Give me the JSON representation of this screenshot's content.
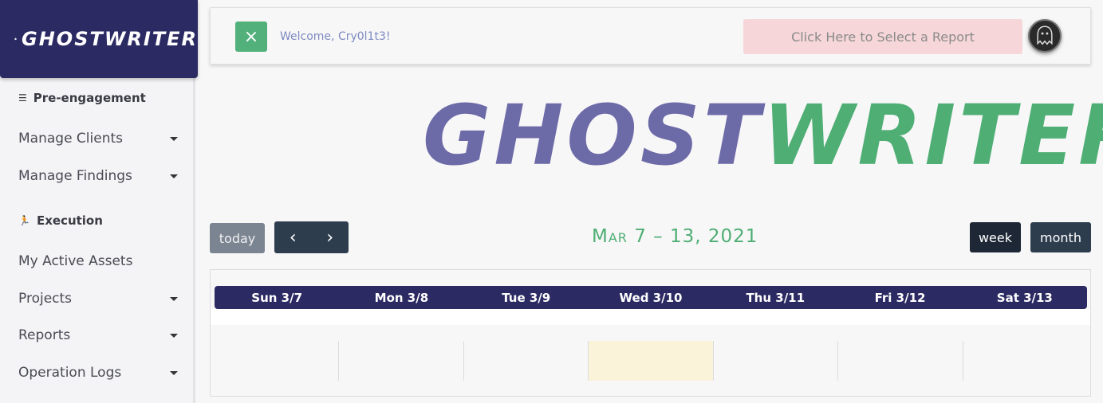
{
  "brand": {
    "name": "GHOSTWRITER",
    "logo_icon": "ghost-icon"
  },
  "sidebar": {
    "sections": [
      {
        "label": "Pre-engagement",
        "icon": "list-icon"
      },
      {
        "label": "Execution",
        "icon": "runner-icon"
      }
    ],
    "items": [
      {
        "label": "Manage Clients"
      },
      {
        "label": "Manage Findings"
      },
      {
        "label": "My Active Assets"
      },
      {
        "label": "Projects"
      },
      {
        "label": "Reports"
      },
      {
        "label": "Operation Logs"
      }
    ]
  },
  "topbar": {
    "close_icon": "×",
    "welcome": "Welcome, Cry0l1t3!",
    "report_button": "Click Here to Select a Report",
    "colors": {
      "close": "#52b07a",
      "report_bg": "#f6d6d9"
    }
  },
  "hero": {
    "part1": "GHOST",
    "part2": "WRITER",
    "colors": {
      "part1": "#6d6aa8",
      "part2": "#4fae74"
    }
  },
  "calendar": {
    "today_label": "today",
    "prev_icon": "‹",
    "next_icon": "›",
    "title": "Mar 7 – 13, 2021",
    "week_label": "week",
    "month_label": "month",
    "days": [
      "Sun 3/7",
      "Mon 3/8",
      "Tue 3/9",
      "Wed 3/10",
      "Thu 3/11",
      "Fri 3/12",
      "Sat 3/13"
    ],
    "today_index": 3
  }
}
